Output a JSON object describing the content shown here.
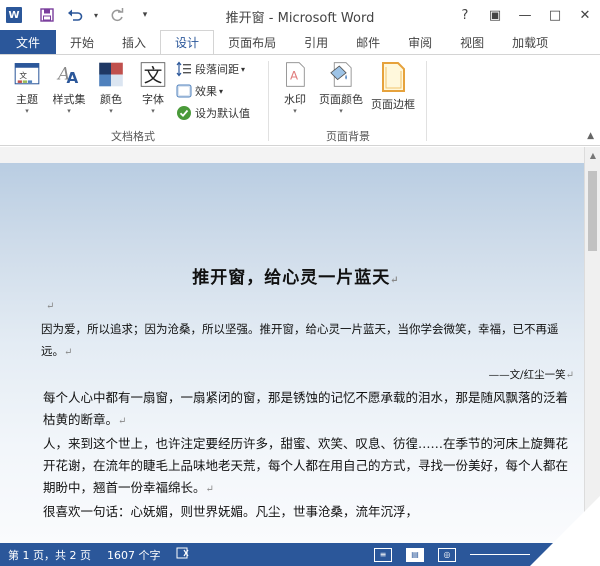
{
  "app": {
    "logo": "W",
    "title": "推开窗 - Microsoft Word"
  },
  "qat": {
    "save_icon": "save-icon",
    "undo_icon": "undo-icon",
    "redo_icon": "redo-icon",
    "customize_icon": "dropdown-icon"
  },
  "window": {
    "help": "?",
    "ribbon_display": "▣",
    "minimize": "—",
    "maximize": "□",
    "close": "✕"
  },
  "tabs": [
    {
      "label": "文件"
    },
    {
      "label": "开始"
    },
    {
      "label": "插入"
    },
    {
      "label": "设计"
    },
    {
      "label": "页面布局"
    },
    {
      "label": "引用"
    },
    {
      "label": "邮件"
    },
    {
      "label": "审阅"
    },
    {
      "label": "视图"
    },
    {
      "label": "加载项"
    }
  ],
  "ribbon": {
    "doc_format": {
      "label": "文档格式",
      "themes": "主题",
      "style_set": "样式集",
      "colors": "颜色",
      "fonts": "字体",
      "paragraph_spacing": "段落间距",
      "effects": "效果",
      "set_default": "设为默认值"
    },
    "page_background": {
      "label": "页面背景",
      "watermark": "水印",
      "page_color": "页面颜色",
      "page_borders": "页面边框"
    }
  },
  "document": {
    "title": "推开窗，给心灵一片蓝天",
    "paragraphs": [
      "因为爱，所以追求；因为沧桑，所以坚强。推开窗，给心灵一片蓝天，当你学会微笑，幸福，已不再遥远。",
      "——文/红尘一笑",
      "每个人心中都有一扇窗，一扇紧闭的窗，那是锈蚀的记忆不愿承载的泪水，那是随风飘落的泛着枯黄的断章。",
      "人，来到这个世上，也许注定要经历许多，甜蜜、欢笑、叹息、彷徨……在季节的河床上旋舞花开花谢，在流年的睫毛上品味地老天荒，每个人都在用自己的方式，寻找一份美好，每个人都在期盼中，翘首一份幸福绵长。",
      "很喜欢一句话：心妩媚，则世界妩媚。凡尘，世事沧桑，流年沉浮，"
    ],
    "para_mark": "↵"
  },
  "status": {
    "page": "第 1 页，共 2 页",
    "words": "1607 个字"
  },
  "colors": {
    "accent": "#2b579a"
  }
}
